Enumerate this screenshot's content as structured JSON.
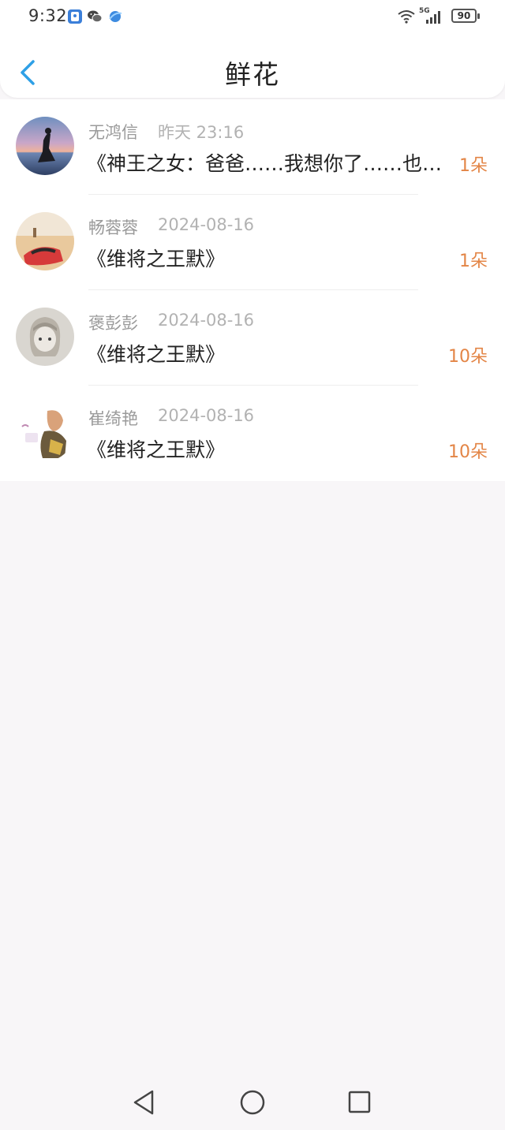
{
  "status_bar": {
    "time": "9:32",
    "network": "5G",
    "battery": "90"
  },
  "header": {
    "title": "鲜花"
  },
  "items": [
    {
      "name": "无鸿信",
      "time": "昨天 23:16",
      "title": "《神王之女：爸爸……我想你了……也想…",
      "count": "1朵"
    },
    {
      "name": "畅蓉蓉",
      "time": "2024-08-16",
      "title": "《维将之王默》",
      "count": "1朵"
    },
    {
      "name": "褒彭彭",
      "time": "2024-08-16",
      "title": "《维将之王默》",
      "count": "10朵"
    },
    {
      "name": "崔绮艳",
      "time": "2024-08-16",
      "title": "《维将之王默》",
      "count": "10朵"
    }
  ],
  "colors": {
    "accent_blue": "#2ea0e6",
    "count_orange": "#e38546",
    "page_bg": "#f8f6f8"
  }
}
